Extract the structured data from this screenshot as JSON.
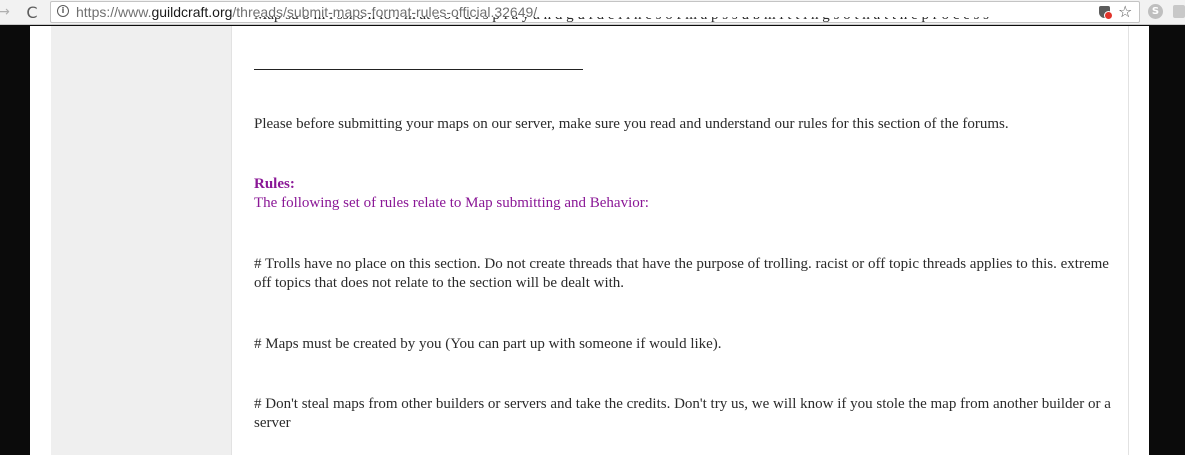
{
  "browser": {
    "back_glyph": "→",
    "reload_glyph": "C",
    "url_scheme": "https://www.",
    "url_host": "guildcraft.org",
    "url_path": "/threads/submit-maps-format-rules-official.32649/",
    "info_glyph": "i",
    "star_glyph": "☆",
    "skype_glyph": "S"
  },
  "post": {
    "intro": "Please before submitting your maps on our server, make sure you read and understand our rules for this section of the forums.",
    "rules_heading": "Rules:",
    "rules_subheading": "The following set of rules relate to Map submitting and Behavior:",
    "rules": [
      "# Trolls have no place on this section. Do not create threads that have the purpose of trolling. racist or off topic threads applies to this. extreme off topics that does not relate to the section will be dealt with.",
      "# Maps must be created by you (You can part up with someone if would like).",
      "# Don't steal maps from other builders or servers and take the credits. Don't try us, we will know if you stole the map from another builder or a server"
    ]
  }
}
